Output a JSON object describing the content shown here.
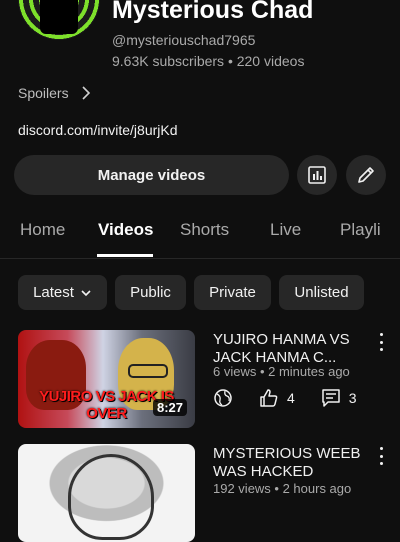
{
  "channel": {
    "name": "Mysterious Chad",
    "handle": "@mysteriouschad7965",
    "stats": "9.63K subscribers • 220 videos",
    "description": "Spoilers",
    "link": "discord.com/invite/j8urjKd"
  },
  "actions": {
    "manage_label": "Manage videos",
    "stats_icon": "analytics-icon",
    "edit_icon": "pencil-icon"
  },
  "tabs": [
    {
      "label": "Home"
    },
    {
      "label": "Videos",
      "active": true
    },
    {
      "label": "Shorts"
    },
    {
      "label": "Live"
    },
    {
      "label": "Playli"
    }
  ],
  "filters": {
    "sort": "Latest",
    "chips": [
      "Public",
      "Private",
      "Unlisted"
    ]
  },
  "videos": [
    {
      "title": "YUJIRO HANMA VS JACK HANMA C...",
      "meta": "6 views • 2 minutes ago",
      "thumb_text": "YUJIRO VS JACK IS OVER",
      "duration": "8:27",
      "likes": "4",
      "comments": "3"
    },
    {
      "title": "MYSTERIOUS WEEB WAS HACKED",
      "meta": "192 views • 2 hours ago"
    }
  ],
  "colors": {
    "background": "#0f0f0f",
    "surface": "#272727",
    "text": "#f1f1f1",
    "muted": "#aaaaaa",
    "avatar_accent": "#7ee02b"
  }
}
